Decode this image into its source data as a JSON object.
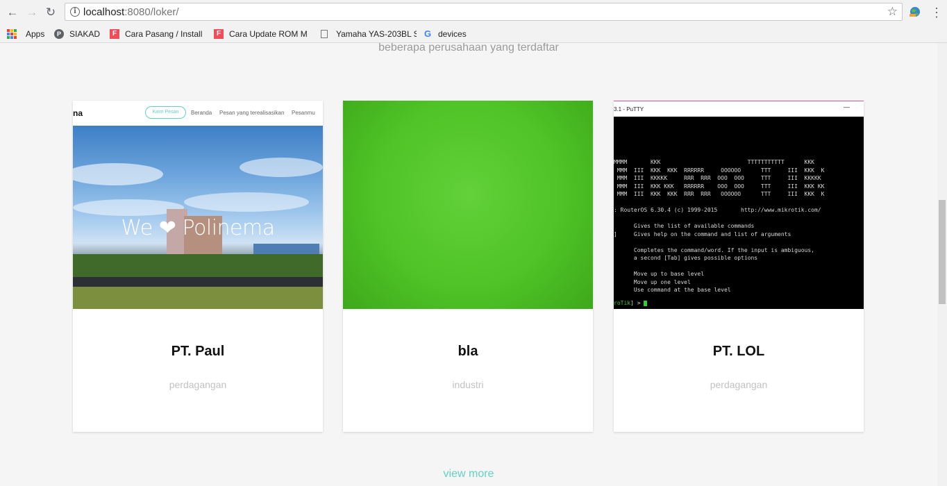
{
  "browser": {
    "url_host": "localhost",
    "url_rest": ":8080/loker/",
    "bookmarks": [
      {
        "label": "Apps",
        "icon": "apps-grid-icon"
      },
      {
        "label": "SIAKAD",
        "icon": "p-circle-icon"
      },
      {
        "label": "Cara Pasang / Install",
        "icon": "f-square-icon"
      },
      {
        "label": "Cara Update ROM M",
        "icon": "f-square-icon"
      },
      {
        "label": "Yamaha YAS-203BL S",
        "icon": "page-icon"
      },
      {
        "label": "devices",
        "icon": "google-icon"
      }
    ]
  },
  "page": {
    "subtitle": "beberapa perusahaan yang terdaftar",
    "view_more": "view more"
  },
  "cards": [
    {
      "name": "PT. Paul",
      "category": "perdagangan",
      "thumb": {
        "logo": "na",
        "button": "Kirim Pesan",
        "links": [
          "Beranda",
          "Pesan yang terealisasikan",
          "Pesanmu"
        ],
        "hero_we": "We",
        "hero_name": "Polinema"
      }
    },
    {
      "name": "bla",
      "category": "industri"
    },
    {
      "name": "PT. LOL",
      "category": "perdagangan",
      "thumb": {
        "window_title": "3.1 - PuTTY",
        "minimize": "—",
        "lines": [
          "MMMM       KKK                          TTTTTTTTTTT      KKK",
          " MMM  III  KKK  KKK  RRRRRR     OOOOOO      TTT     III  KKK  K",
          " MMM  III  KKKKK     RRR  RRR  OOO  OOO     TTT     III  KKKKK",
          " MMM  III  KKK KKK   RRRRRR    OOO  OOO     TTT     III  KKK KK",
          " MMM  III  KKK  KKK  RRR  RRR   OOOOOO      TTT     III  KKK  K",
          "",
          ": RouterOS 6.30.4 (c) 1999-2015       http://www.mikrotik.com/",
          "",
          "      Gives the list of available commands",
          "]     Gives help on the command and list of arguments",
          "",
          "      Completes the command/word. If the input is ambiguous,",
          "      a second [Tab] gives possible options",
          "",
          "      Move up to base level",
          "      Move up one level",
          "      Use command at the base level"
        ],
        "prompt_green": "roTik",
        "prompt_rest": "] > "
      }
    }
  ],
  "colors": {
    "accent": "#5fd3c5",
    "page_bg": "#f5f5f5"
  }
}
